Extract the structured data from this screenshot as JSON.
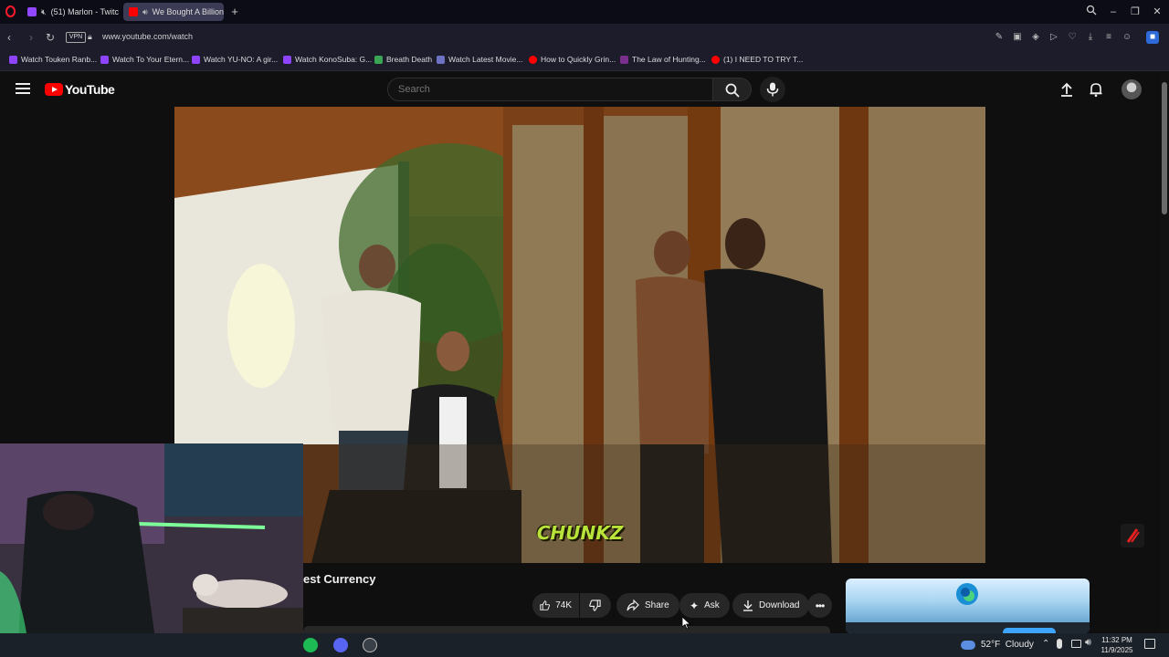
{
  "browser": {
    "tabs": [
      {
        "label": "(51) Marlon - Twitch",
        "active": false,
        "icon": "twitch-icon",
        "color": "#9146ff"
      },
      {
        "label": "We Bought A Billion C",
        "active": true,
        "icon": "youtube-icon",
        "color": "#ff0000"
      }
    ],
    "vpn_label": "VPN",
    "url": "www.youtube.com/watch",
    "bookmarks": [
      {
        "label": "Watch Touken Ranb...",
        "color": "#8e44ff"
      },
      {
        "label": "Watch To Your Etern...",
        "color": "#8e44ff"
      },
      {
        "label": "Watch YU-NO: A gir...",
        "color": "#8e44ff"
      },
      {
        "label": "Watch KonoSuba: G...",
        "color": "#8e44ff"
      },
      {
        "label": "Breath Death",
        "color": "#3aa655"
      },
      {
        "label": "Watch Latest Movie...",
        "color": "#6d72c3"
      },
      {
        "label": "How to Quickly Grin...",
        "color": "#ff0000"
      },
      {
        "label": "The Law of Hunting...",
        "color": "#7a2f8f"
      },
      {
        "label": "(1) I NEED TO TRY T...",
        "color": "#ff0000"
      }
    ]
  },
  "youtube": {
    "logo_text": "YouTube",
    "search_placeholder": "Search",
    "video": {
      "caption": "CHUNKZ",
      "title_visible": "est Currency"
    },
    "actions": {
      "likes": "74K",
      "share": "Share",
      "ask": "Ask",
      "download": "Download"
    }
  },
  "taskbar": {
    "weather": "52°F  Cloudy",
    "time": "11:32 PM",
    "date": "11/9/2025"
  },
  "colors": {
    "accent": "#ff0000",
    "caption": "#b9e23a"
  }
}
